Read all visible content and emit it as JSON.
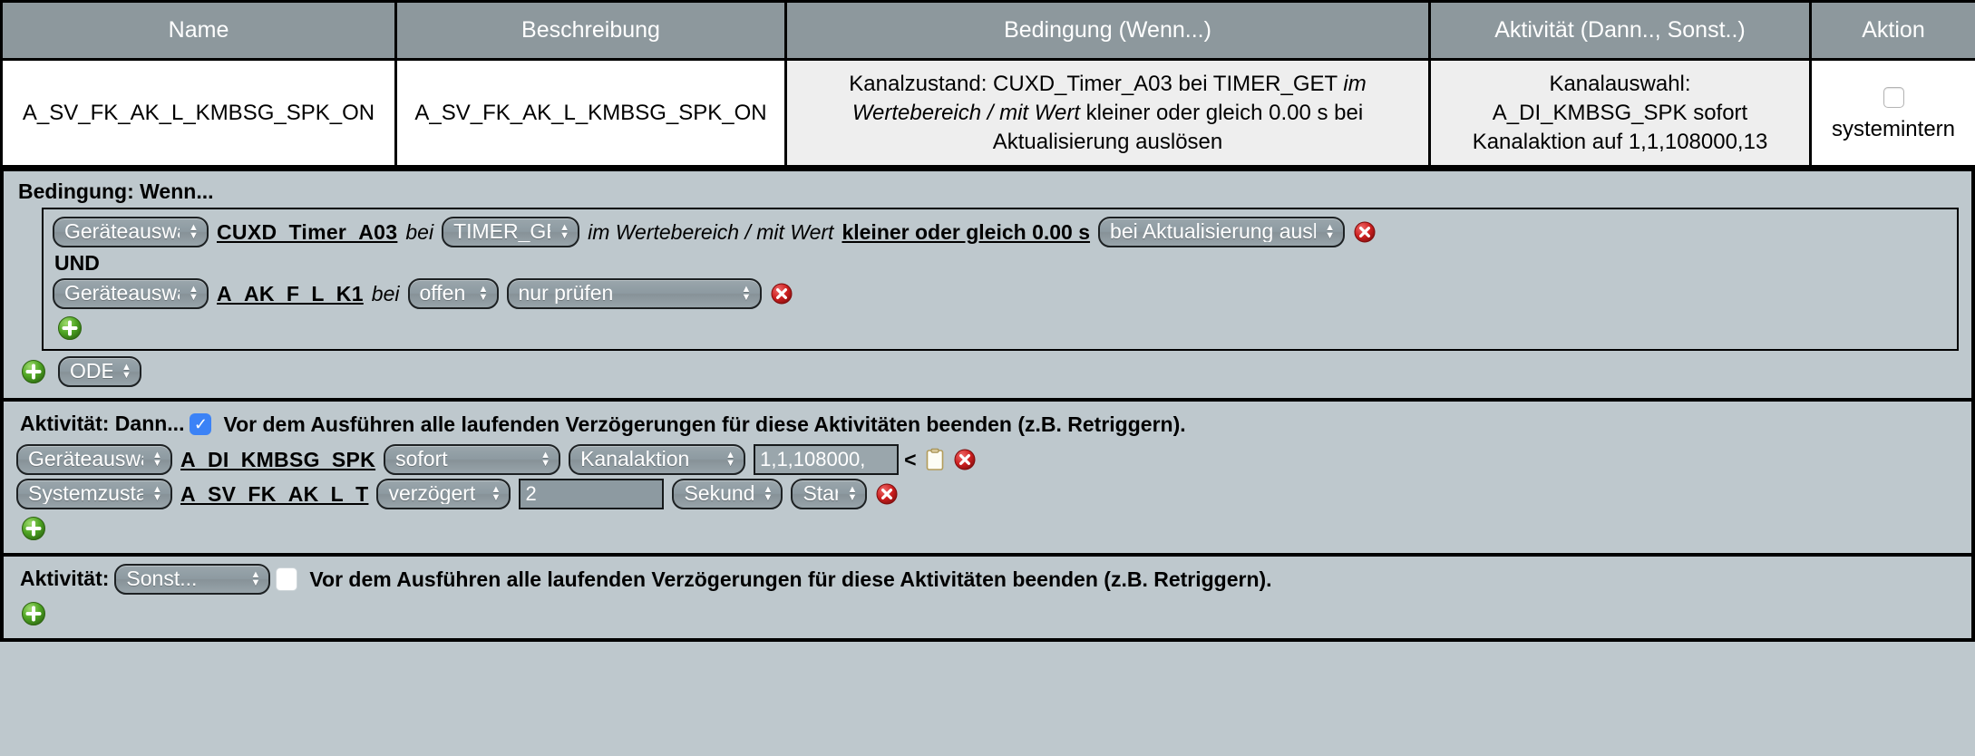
{
  "summary_table": {
    "columns": [
      "Name",
      "Beschreibung",
      "Bedingung (Wenn...)",
      "Aktivität (Dann.., Sonst..)",
      "Aktion"
    ],
    "row": {
      "name": "A_SV_FK_AK_L_KMBSG_SPK_ON",
      "beschreibung": "A_SV_FK_AK_L_KMBSG_SPK_ON",
      "bedingung_part1": "Kanalzustand: CUXD_Timer_A03 bei TIMER_GET ",
      "bedingung_italic": "im Wertebereich / mit Wert",
      "bedingung_part2": " kleiner oder gleich 0.00 s bei Aktualisierung auslösen",
      "aktivitaet_line1": "Kanalauswahl:",
      "aktivitaet_line2": "A_DI_KMBSG_SPK sofort",
      "aktivitaet_line3": "Kanalaktion auf 1,1,108000,13",
      "aktion_checkbox_label": "systemintern",
      "aktion_checkbox_checked": false
    }
  },
  "condition_panel": {
    "title": "Bedingung: Wenn...",
    "rows": [
      {
        "device_select": "Geräteauswahl",
        "channel": "CUXD_Timer_A03",
        "bei": "bei",
        "datapoint_select": "TIMER_GET",
        "range_text_italic": "im Wertebereich / mit Wert",
        "condition_value": "kleiner oder gleich 0.00 s",
        "trigger_select": "bei Aktualisierung auslösen",
        "delete_icon": "delete-icon"
      },
      {
        "operator": "UND",
        "device_select": "Geräteauswahl",
        "channel": "A_AK_F_L_K1",
        "bei": "bei",
        "state_select": "offen",
        "mode_select": "nur prüfen",
        "delete_icon": "delete-icon"
      }
    ],
    "add_inner_icon": "add-icon",
    "add_outer_icon": "add-icon",
    "logic_select": "ODER"
  },
  "then_panel": {
    "title": "Aktivität: Dann...",
    "retrigger_checked": true,
    "retrigger_label": "Vor dem Ausführen alle laufenden Verzögerungen für diese Aktivitäten beenden (z.B. Retriggern).",
    "rows": [
      {
        "kind_select": "Geräteauswahl",
        "channel": "A_DI_KMBSG_SPK",
        "timing_select": "sofort",
        "action_select": "Kanalaktion",
        "value_input": "1,1,108000,",
        "lt_marker": "<",
        "note_icon": "note-icon",
        "delete_icon": "delete-icon"
      },
      {
        "kind_select": "Systemzustand",
        "channel": "A_SV_FK_AK_L_T",
        "timing_select": "verzögert um",
        "delay_value": "2",
        "unit_select": "Sekunden",
        "start_select": "Start",
        "delete_icon": "delete-icon"
      }
    ],
    "add_icon": "add-icon"
  },
  "else_panel": {
    "title": "Aktivität:",
    "else_select": "Sonst...",
    "retrigger_checked": false,
    "retrigger_label": "Vor dem Ausführen alle laufenden Verzögerungen für diese Aktivitäten beenden (z.B. Retriggern).",
    "add_icon": "add-icon"
  },
  "colors": {
    "header_bg": "#8d989d",
    "panel_bg": "#bec8cd",
    "select_bg": "#8d9aa1",
    "delete_red": "#cc2222",
    "add_green": "#5aaa2a",
    "checkbox_blue": "#3b82f6"
  }
}
